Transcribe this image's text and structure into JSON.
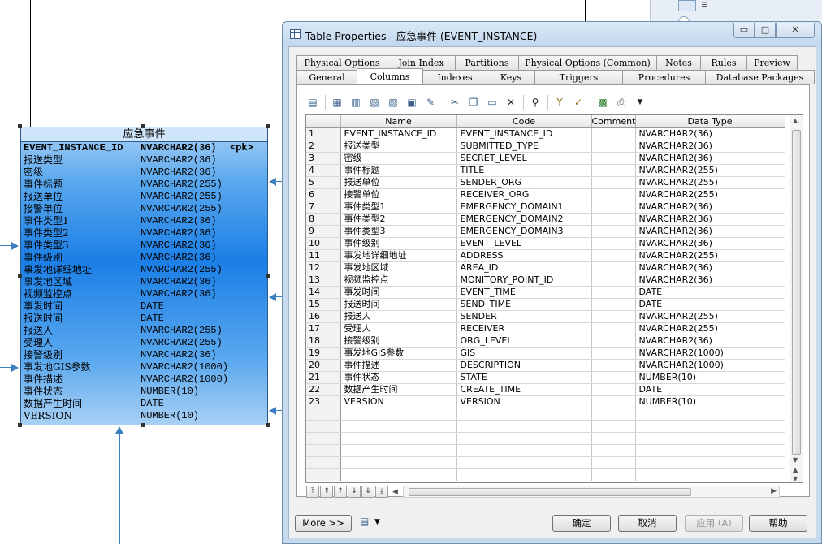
{
  "diagram": {
    "entity_title": "应急事件",
    "pk_row": {
      "name": "EVENT_INSTANCE_ID",
      "type": "NVARCHAR2(36)",
      "pk": "<pk>"
    },
    "rows": [
      {
        "name": "报送类型",
        "type": "NVARCHAR2(36)"
      },
      {
        "name": "密级",
        "type": "NVARCHAR2(36)"
      },
      {
        "name": "事件标题",
        "type": "NVARCHAR2(255)"
      },
      {
        "name": "报送单位",
        "type": "NVARCHAR2(255)"
      },
      {
        "name": "接警单位",
        "type": "NVARCHAR2(255)"
      },
      {
        "name": "事件类型1",
        "type": "NVARCHAR2(36)"
      },
      {
        "name": "事件类型2",
        "type": "NVARCHAR2(36)"
      },
      {
        "name": "事件类型3",
        "type": "NVARCHAR2(36)"
      },
      {
        "name": "事件级别",
        "type": "NVARCHAR2(36)"
      },
      {
        "name": "事发地详细地址",
        "type": "NVARCHAR2(255)"
      },
      {
        "name": "事发地区域",
        "type": "NVARCHAR2(36)"
      },
      {
        "name": "视频监控点",
        "type": "NVARCHAR2(36)"
      },
      {
        "name": "事发时间",
        "type": "DATE"
      },
      {
        "name": "报送时间",
        "type": "DATE"
      },
      {
        "name": "报送人",
        "type": "NVARCHAR2(255)"
      },
      {
        "name": "受理人",
        "type": "NVARCHAR2(255)"
      },
      {
        "name": "接警级别",
        "type": "NVARCHAR2(36)"
      },
      {
        "name": "事发地GIS参数",
        "type": "NVARCHAR2(1000)"
      },
      {
        "name": "事件描述",
        "type": "NVARCHAR2(1000)"
      },
      {
        "name": "事件状态",
        "type": "NUMBER(10)"
      },
      {
        "name": "数据产生时间",
        "type": "DATE"
      },
      {
        "name": "VERSION",
        "type": "NUMBER(10)"
      }
    ]
  },
  "dialog": {
    "title": "Table Properties - 应急事件 (EVENT_INSTANCE)",
    "window_buttons": {
      "minimize": "▭",
      "maximize": "□",
      "close": "✕"
    },
    "tabs_row1": [
      "Physical Options",
      "Join Index",
      "Partitions",
      "Physical Options (Common)",
      "Notes",
      "Rules",
      "Preview"
    ],
    "tabs_row2": [
      "General",
      "Columns",
      "Indexes",
      "Keys",
      "Triggers",
      "Procedures",
      "Database Packages"
    ],
    "active_tab": "Columns",
    "columns_header": [
      "Name",
      "Code",
      "Comment",
      "Data Type"
    ],
    "columns": [
      [
        "1",
        "EVENT_INSTANCE_ID",
        "EVENT_INSTANCE_ID",
        "",
        "NVARCHAR2(36)"
      ],
      [
        "2",
        "报送类型",
        "SUBMITTED_TYPE",
        "",
        "NVARCHAR2(36)"
      ],
      [
        "3",
        "密级",
        "SECRET_LEVEL",
        "",
        "NVARCHAR2(36)"
      ],
      [
        "4",
        "事件标题",
        "TITLE",
        "",
        "NVARCHAR2(255)"
      ],
      [
        "5",
        "报送单位",
        "SENDER_ORG",
        "",
        "NVARCHAR2(255)"
      ],
      [
        "6",
        "接警单位",
        "RECEIVER_ORG",
        "",
        "NVARCHAR2(255)"
      ],
      [
        "7",
        "事件类型1",
        "EMERGENCY_DOMAIN1",
        "",
        "NVARCHAR2(36)"
      ],
      [
        "8",
        "事件类型2",
        "EMERGENCY_DOMAIN2",
        "",
        "NVARCHAR2(36)"
      ],
      [
        "9",
        "事件类型3",
        "EMERGENCY_DOMAIN3",
        "",
        "NVARCHAR2(36)"
      ],
      [
        "10",
        "事件级别",
        "EVENT_LEVEL",
        "",
        "NVARCHAR2(36)"
      ],
      [
        "11",
        "事发地详细地址",
        "ADDRESS",
        "",
        "NVARCHAR2(255)"
      ],
      [
        "12",
        "事发地区域",
        "AREA_ID",
        "",
        "NVARCHAR2(36)"
      ],
      [
        "13",
        "视频监控点",
        "MONITORY_POINT_ID",
        "",
        "NVARCHAR2(36)"
      ],
      [
        "14",
        "事发时间",
        "EVENT_TIME",
        "",
        "DATE"
      ],
      [
        "15",
        "报送时间",
        "SEND_TIME",
        "",
        "DATE"
      ],
      [
        "16",
        "报送人",
        "SENDER",
        "",
        "NVARCHAR2(255)"
      ],
      [
        "17",
        "受理人",
        "RECEIVER",
        "",
        "NVARCHAR2(255)"
      ],
      [
        "18",
        "接警级别",
        "ORG_LEVEL",
        "",
        "NVARCHAR2(36)"
      ],
      [
        "19",
        "事发地GIS参数",
        "GIS",
        "",
        "NVARCHAR2(1000)"
      ],
      [
        "20",
        "事件描述",
        "DESCRIPTION",
        "",
        "NVARCHAR2(1000)"
      ],
      [
        "21",
        "事件状态",
        "STATE",
        "",
        "NUMBER(10)"
      ],
      [
        "22",
        "数据产生时间",
        "CREATE_TIME",
        "",
        "DATE"
      ],
      [
        "23",
        "VERSION",
        "VERSION",
        "",
        "NUMBER(10)"
      ]
    ],
    "empty_row_count": 6,
    "buttons": {
      "more": "More >>",
      "ok": "确定",
      "cancel": "取消",
      "apply": "应用 (A)",
      "help": "帮助"
    }
  },
  "colors": {
    "entity_blue": "#1b7fe6",
    "link_blue": "#3d7fbf",
    "dialog_frame": "#c7d9ec"
  }
}
